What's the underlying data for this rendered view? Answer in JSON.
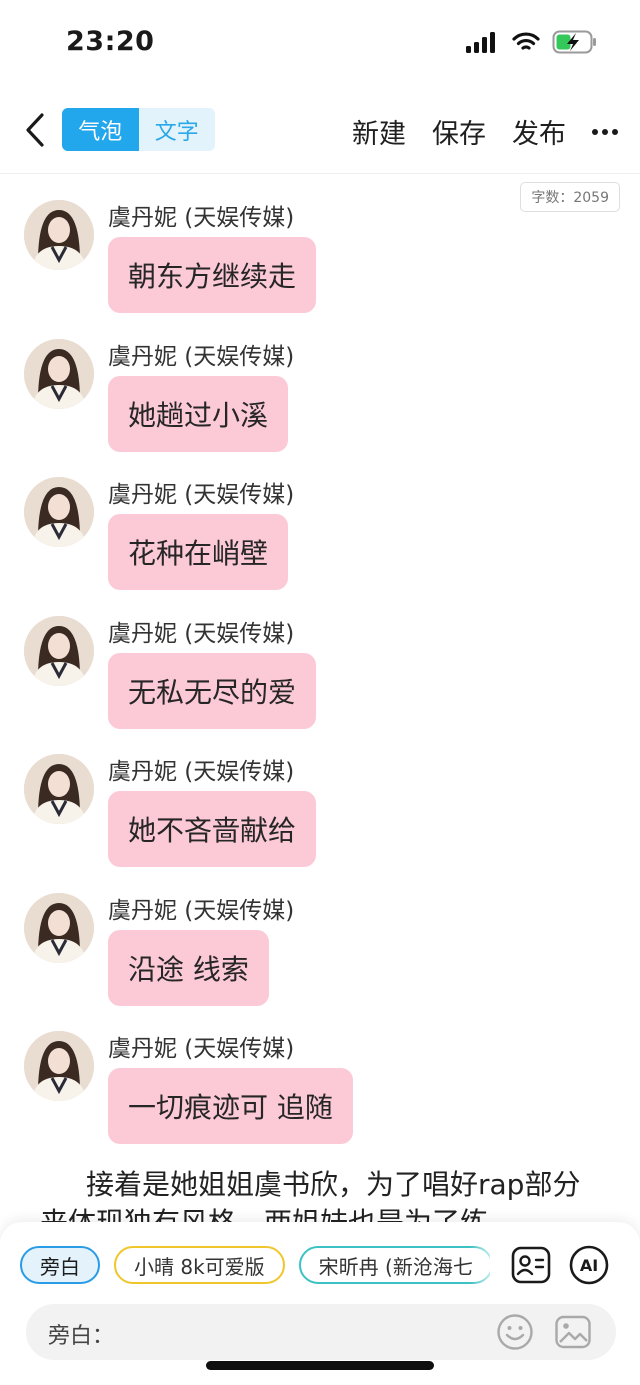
{
  "status_bar": {
    "time": "23:20"
  },
  "nav": {
    "tabs": [
      {
        "label": "气泡",
        "active": true
      },
      {
        "label": "文字",
        "active": false
      }
    ],
    "actions": {
      "new": "新建",
      "save": "保存",
      "publish": "发布"
    }
  },
  "word_count": "字数：2059",
  "messages": [
    {
      "name": "虞丹妮 (天娱传媒)",
      "text": "朝东方继续走"
    },
    {
      "name": "虞丹妮 (天娱传媒)",
      "text": "她趟过小溪"
    },
    {
      "name": "虞丹妮 (天娱传媒)",
      "text": "花种在峭壁"
    },
    {
      "name": "虞丹妮 (天娱传媒)",
      "text": "无私无尽的爱"
    },
    {
      "name": "虞丹妮 (天娱传媒)",
      "text": "她不吝啬献给"
    },
    {
      "name": "虞丹妮 (天娱传媒)",
      "text": "沿途 线索"
    },
    {
      "name": "虞丹妮 (天娱传媒)",
      "text": "一切痕迹可 追随"
    }
  ],
  "narration": "接着是她姐姐虞书欣，为了唱好rap部分来体现独有风格，两姐妹也是为了练",
  "roles": [
    {
      "label": "旁白",
      "border_color": "#2a9ce6"
    },
    {
      "label": "小晴 8k可爱版",
      "border_color": "#efc62b"
    },
    {
      "label": "宋昕冉 (新沧海七",
      "border_color": "#3cc1c4"
    }
  ],
  "composer": {
    "label": "旁白：",
    "placeholder": ""
  },
  "icons": {
    "ai_label": "AI",
    "names": [
      "back-chevron-icon",
      "more-icon",
      "signal-icon",
      "wifi-icon",
      "battery-charging-icon",
      "contact-card-icon",
      "ai-icon",
      "emoji-icon",
      "image-icon"
    ]
  },
  "colors": {
    "accent": "#22a6ec",
    "bubble": "#fcc9d7"
  }
}
